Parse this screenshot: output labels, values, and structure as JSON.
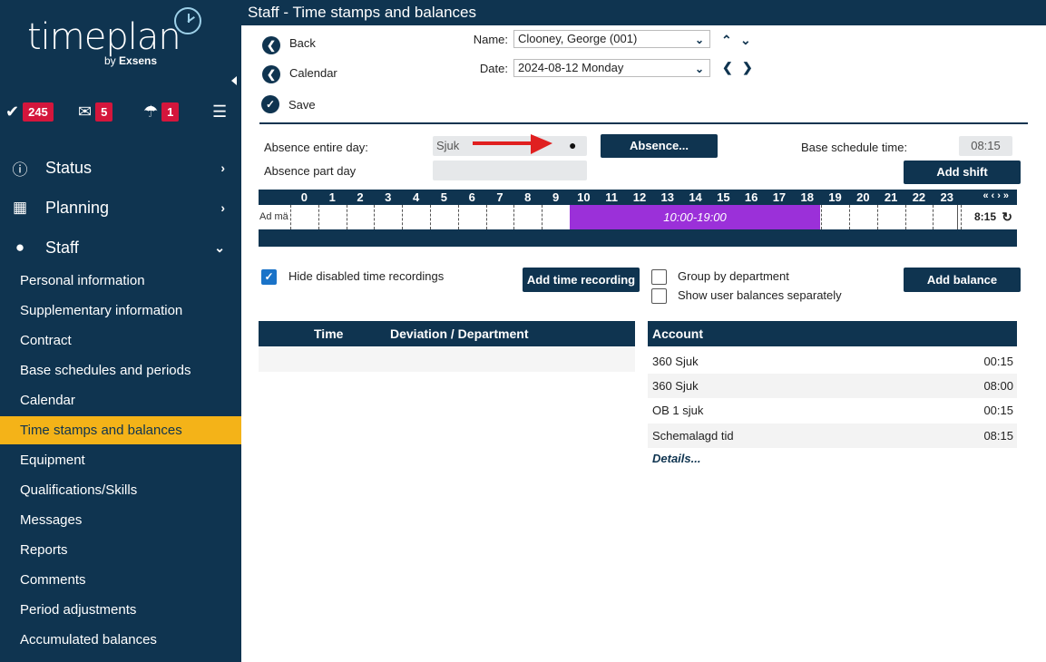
{
  "brand": {
    "name": "timeplan",
    "by": "by",
    "company": "Exsens"
  },
  "badges": {
    "tasks_count": "245",
    "messages_count": "5",
    "absence_count": "1"
  },
  "nav": {
    "status": "Status",
    "planning": "Planning",
    "staff": "Staff",
    "staff_items": [
      "Personal information",
      "Supplementary information",
      "Contract",
      "Base schedules and periods",
      "Calendar",
      "Time stamps and balances",
      "Equipment",
      "Qualifications/Skills",
      "Messages",
      "Reports",
      "Comments",
      "Period adjustments",
      "Accumulated balances"
    ]
  },
  "header": {
    "title": "Staff - Time stamps and balances"
  },
  "actions": {
    "back": "Back",
    "calendar": "Calendar",
    "save": "Save"
  },
  "filters": {
    "name_label": "Name:",
    "name_value": "Clooney, George (001)",
    "date_label": "Date:",
    "date_value": "2024-08-12 Monday"
  },
  "absence": {
    "entire_day_label": "Absence entire day:",
    "entire_day_value": "Sjuk",
    "part_day_label": "Absence part day",
    "part_day_value": "",
    "absence_button": "Absence...",
    "base_schedule_label": "Base schedule time:",
    "base_schedule_value": "08:15",
    "add_shift_button": "Add shift"
  },
  "timeline": {
    "hours": [
      "0",
      "1",
      "2",
      "3",
      "4",
      "5",
      "6",
      "7",
      "8",
      "9",
      "10",
      "11",
      "12",
      "13",
      "14",
      "15",
      "16",
      "17",
      "18",
      "19",
      "20",
      "21",
      "22",
      "23"
    ],
    "row_label": "Ad mä",
    "shift_label": "10:00-19:00",
    "total": "8:15"
  },
  "options": {
    "hide_disabled_label": "Hide disabled time recordings",
    "add_time_recording_button": "Add time recording",
    "group_by_department_label": "Group by department",
    "show_user_balances_label": "Show user balances separately",
    "add_balance_button": "Add balance"
  },
  "time_table": {
    "col_time": "Time",
    "col_deviation": "Deviation / Department"
  },
  "accounts": {
    "header": "Account",
    "rows": [
      {
        "name": "360 Sjuk",
        "value": "00:15"
      },
      {
        "name": "360 Sjuk",
        "value": "08:00"
      },
      {
        "name": "OB 1 sjuk",
        "value": "00:15"
      },
      {
        "name": "Schemalagd tid",
        "value": "08:15"
      }
    ],
    "details_link": "Details..."
  },
  "colors": {
    "navy": "#0f3450",
    "accent_yellow": "#f4b318",
    "badge_red": "#d4163c",
    "shift_purple": "#9b30d9",
    "annotation_arrow": "#e02020"
  }
}
